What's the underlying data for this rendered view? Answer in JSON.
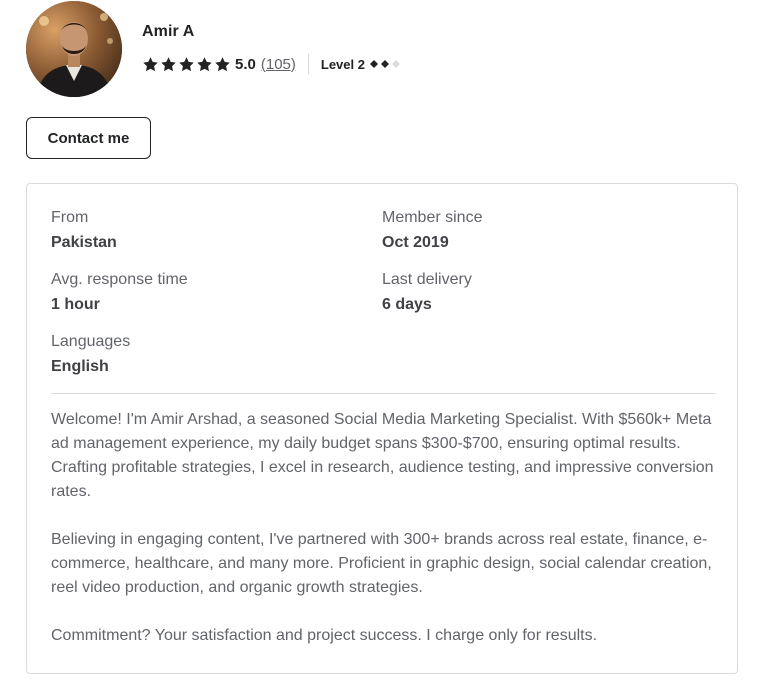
{
  "seller": {
    "name": "Amir A",
    "rating_score": "5.0",
    "rating_count": "(105)",
    "stars_filled": 5,
    "level_label": "Level 2",
    "level_diamonds_filled": 2,
    "level_diamonds_total": 3,
    "avatar_icon": "avatar-photo"
  },
  "actions": {
    "contact_label": "Contact me"
  },
  "stats": {
    "from_label": "From",
    "from_value": "Pakistan",
    "member_since_label": "Member since",
    "member_since_value": "Oct 2019",
    "response_time_label": "Avg. response time",
    "response_time_value": "1 hour",
    "last_delivery_label": "Last delivery",
    "last_delivery_value": "6 days",
    "languages_label": "Languages",
    "languages_value": "English"
  },
  "bio": {
    "paragraphs": [
      "Welcome! I'm Amir Arshad, a seasoned Social Media Marketing Specialist. With $560k+ Meta ad management experience, my daily budget spans $300-$700, ensuring optimal results. Crafting profitable strategies, I excel in research, audience testing, and impressive conversion rates.",
      "Believing in engaging content, I've partnered with 300+ brands across real estate, finance, e-commerce, healthcare, and many more. Proficient in graphic design, social calendar creation, reel video production, and organic growth strategies.",
      "Commitment? Your satisfaction and project success. I charge only for results."
    ]
  },
  "colors": {
    "text_dark": "#222325",
    "text_muted": "#62646a",
    "border": "#dadbdd",
    "diamond_filled": "#222325",
    "diamond_empty": "#dadbdd"
  }
}
